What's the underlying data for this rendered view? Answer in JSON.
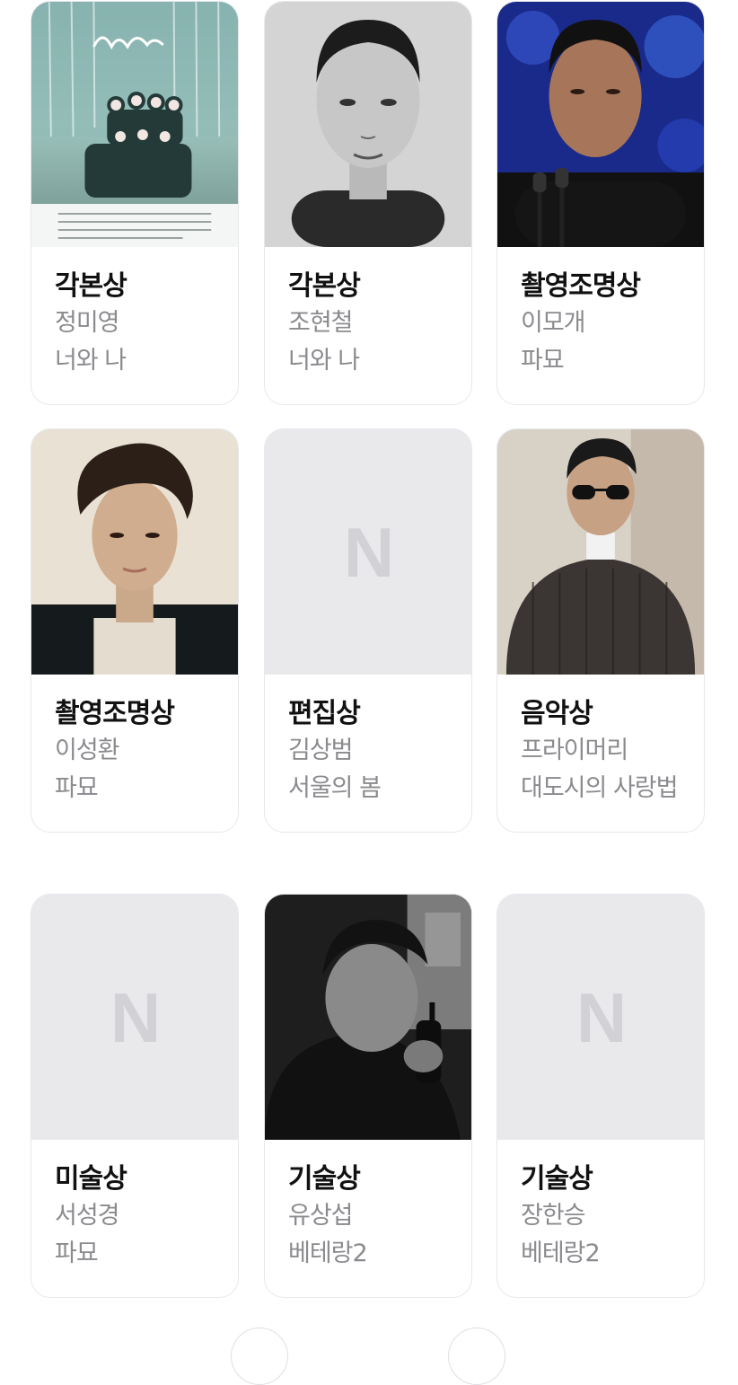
{
  "cards": [
    {
      "award": "각본상",
      "person": "정미영",
      "work": "너와 나",
      "image": "poster-photo"
    },
    {
      "award": "각본상",
      "person": "조현철",
      "work": "너와 나",
      "image": "portrait-photo"
    },
    {
      "award": "촬영조명상",
      "person": "이모개",
      "work": "파묘",
      "image": "portrait-photo"
    },
    {
      "award": "촬영조명상",
      "person": "이성환",
      "work": "파묘",
      "image": "portrait-photo"
    },
    {
      "award": "편집상",
      "person": "김상범",
      "work": "서울의 봄",
      "image": "placeholder",
      "placeholder_logo": "N"
    },
    {
      "award": "음악상",
      "person": "프라이머리",
      "work": "대도시의 사랑법",
      "image": "portrait-photo"
    },
    {
      "award": "미술상",
      "person": "서성경",
      "work": "파묘",
      "image": "placeholder",
      "placeholder_logo": "N"
    },
    {
      "award": "기술상",
      "person": "유상섭",
      "work": "베테랑2",
      "image": "portrait-photo"
    },
    {
      "award": "기술상",
      "person": "장한승",
      "work": "베테랑2",
      "image": "placeholder",
      "placeholder_logo": "N"
    }
  ],
  "pagination": {
    "prev_icon": "chevron-left-icon",
    "next_icon": "chevron-right-icon"
  }
}
